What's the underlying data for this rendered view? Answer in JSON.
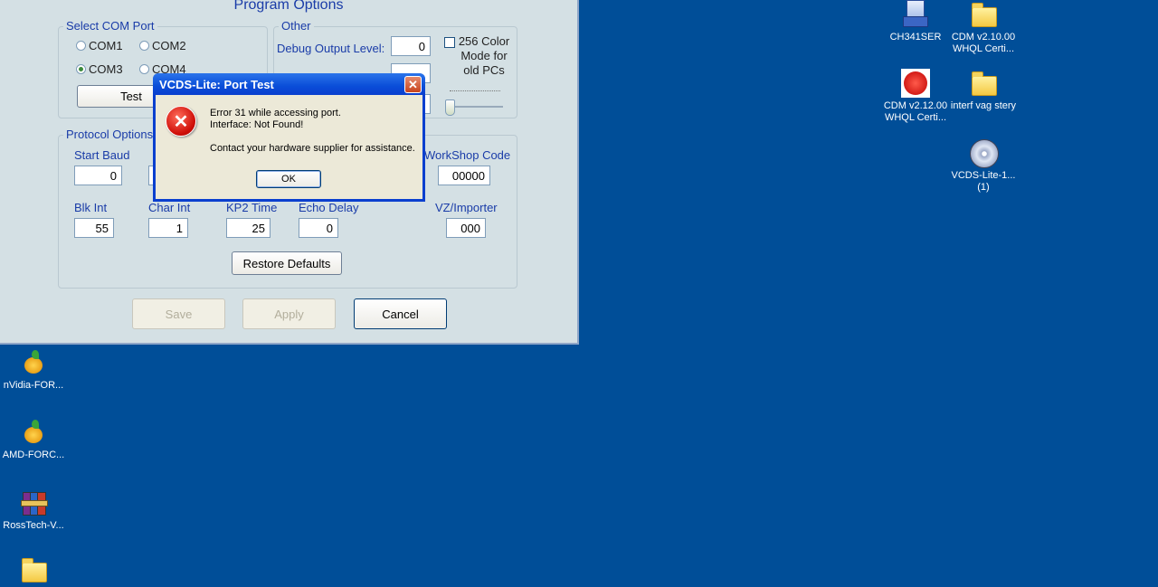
{
  "options": {
    "title": "Program Options",
    "com_group": {
      "label": "Select COM Port",
      "ports": [
        "COM1",
        "COM2",
        "COM3",
        "COM4"
      ],
      "selected": "COM3",
      "test_label": "Test"
    },
    "other_group": {
      "label": "Other",
      "debug_label": "Debug Output Level:",
      "debug_value": "0",
      "color_mode_label": "256 Color Mode for old PCs"
    },
    "protocol_group": {
      "label": "Protocol Options",
      "start_baud_label": "Start Baud",
      "start_baud_value": "0",
      "workshop_code_label": "WorkShop Code",
      "workshop_code_value": "00000",
      "blk_int_label": "Blk Int",
      "blk_int_value": "55",
      "char_int_label": "Char Int",
      "char_int_value": "1",
      "kp2_time_label": "KP2 Time",
      "kp2_time_value": "25",
      "echo_delay_label": "Echo Delay",
      "echo_delay_value": "0",
      "importer_label": "VZ/Importer",
      "importer_value": "000",
      "restore_label": "Restore Defaults"
    },
    "buttons": {
      "save": "Save",
      "apply": "Apply",
      "cancel": "Cancel"
    }
  },
  "dialog": {
    "title": "VCDS-Lite: Port Test",
    "line1": "Error 31 while accessing port.",
    "line2": "Interface:  Not Found!",
    "line3": "Contact your hardware supplier for assistance.",
    "ok_label": "OK",
    "icon": "error-icon"
  },
  "desktop": {
    "icons": [
      {
        "label": "CH341SER",
        "icon": "installer-icon"
      },
      {
        "label": "CDM v2.10.00 WHQL Certi...",
        "icon": "folder-icon"
      },
      {
        "label": "CDM v2.12.00 WHQL Certi...",
        "icon": "ftdi-icon"
      },
      {
        "label": "interf vag stery",
        "icon": "folder-icon"
      },
      {
        "label": "VCDS-Lite-1... (1)",
        "icon": "disc-icon"
      },
      {
        "label": "nVidia-FOR...",
        "icon": "driver-icon"
      },
      {
        "label": "AMD-FORC...",
        "icon": "driver-icon"
      },
      {
        "label": "RossTech-V...",
        "icon": "archive-icon"
      }
    ]
  },
  "colors": {
    "desktop": "#004e98",
    "accent": "#1a3ca8",
    "title_bar": "#0a3fcf"
  }
}
